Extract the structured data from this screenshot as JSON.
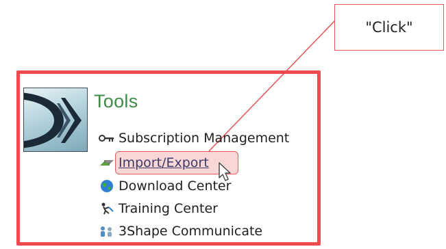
{
  "callout": {
    "text": "\"Click\""
  },
  "tools": {
    "title": "Tools",
    "items": [
      {
        "label": "Subscription Management",
        "icon": "key-icon"
      },
      {
        "label": "Import/Export",
        "icon": "import-export-icon"
      },
      {
        "label": "Download Center",
        "icon": "globe-icon"
      },
      {
        "label": "Training Center",
        "icon": "training-icon"
      },
      {
        "label": "3Shape Communicate",
        "icon": "communicate-icon"
      }
    ]
  },
  "colors": {
    "frame": "#ef4b4f",
    "title": "#3f8a45",
    "highlight": "#ea5c5c"
  }
}
